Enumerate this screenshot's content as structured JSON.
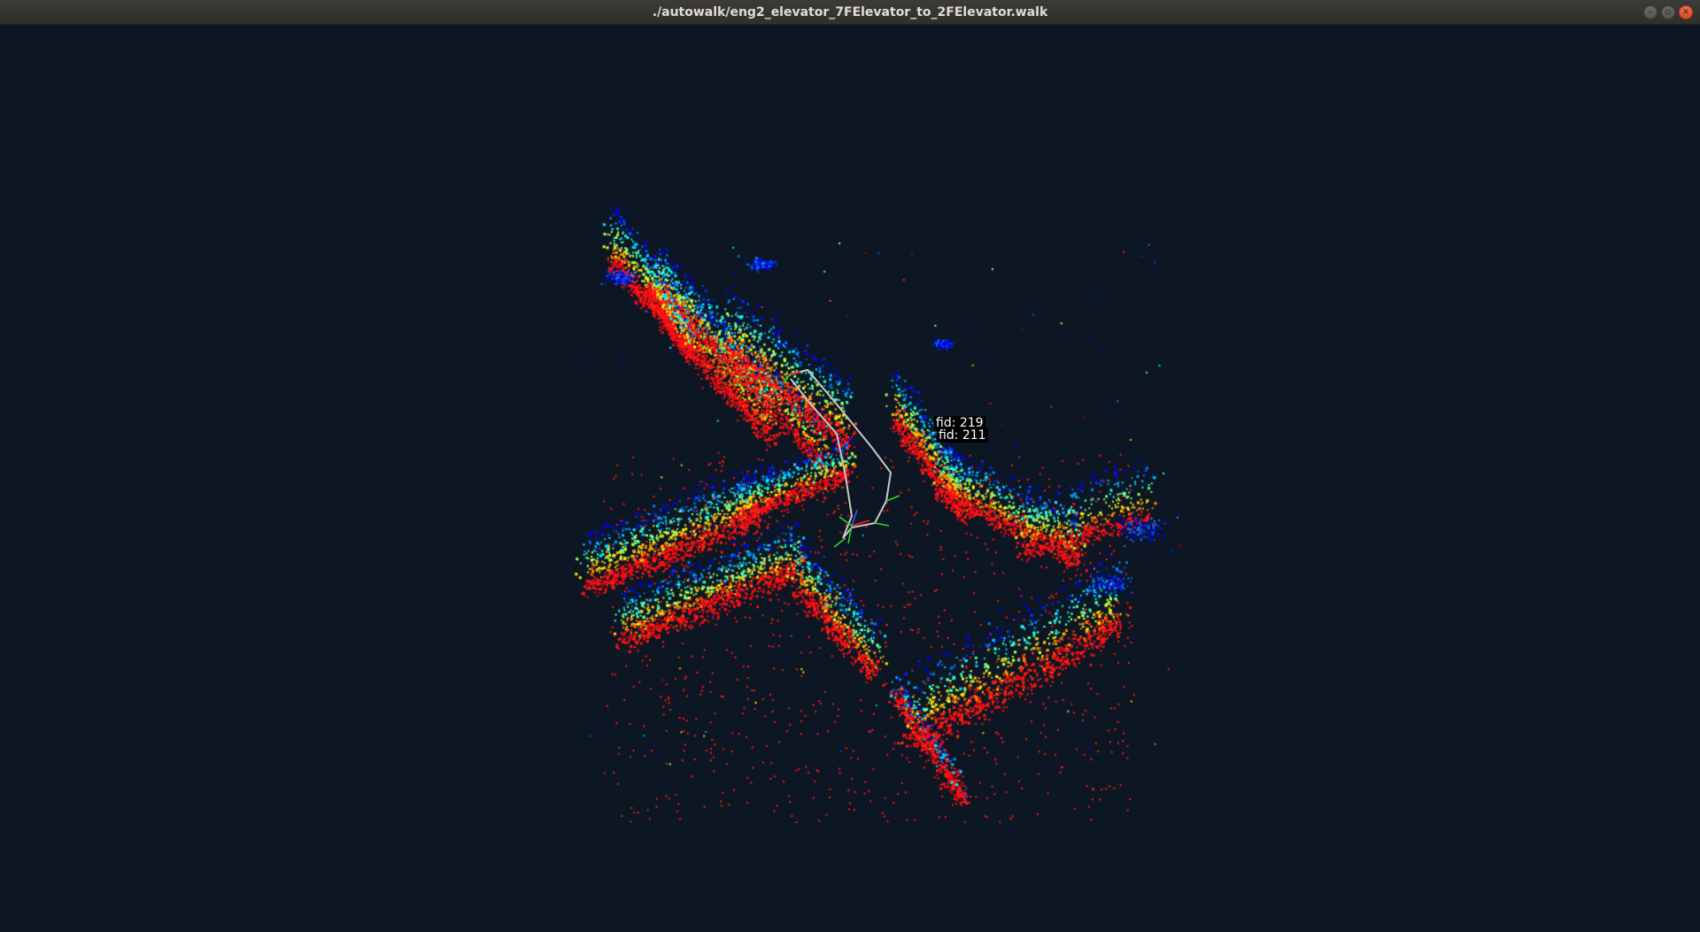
{
  "window": {
    "title": "./autowalk/eng2_elevator_7FElevator_to_2FElevator.walk",
    "controls": {
      "minimize_glyph": "–",
      "maximize_glyph": "▫",
      "close_glyph": "×"
    }
  },
  "viewport": {
    "background": "#0c1723",
    "fiducials": [
      {
        "label": "fid: 219"
      },
      {
        "label": "fid: 211"
      }
    ],
    "colors": {
      "path": "#c8c8c8",
      "axis_x": "#ff2020",
      "axis_y": "#20e020",
      "axis_z": "#4060ff"
    }
  }
}
